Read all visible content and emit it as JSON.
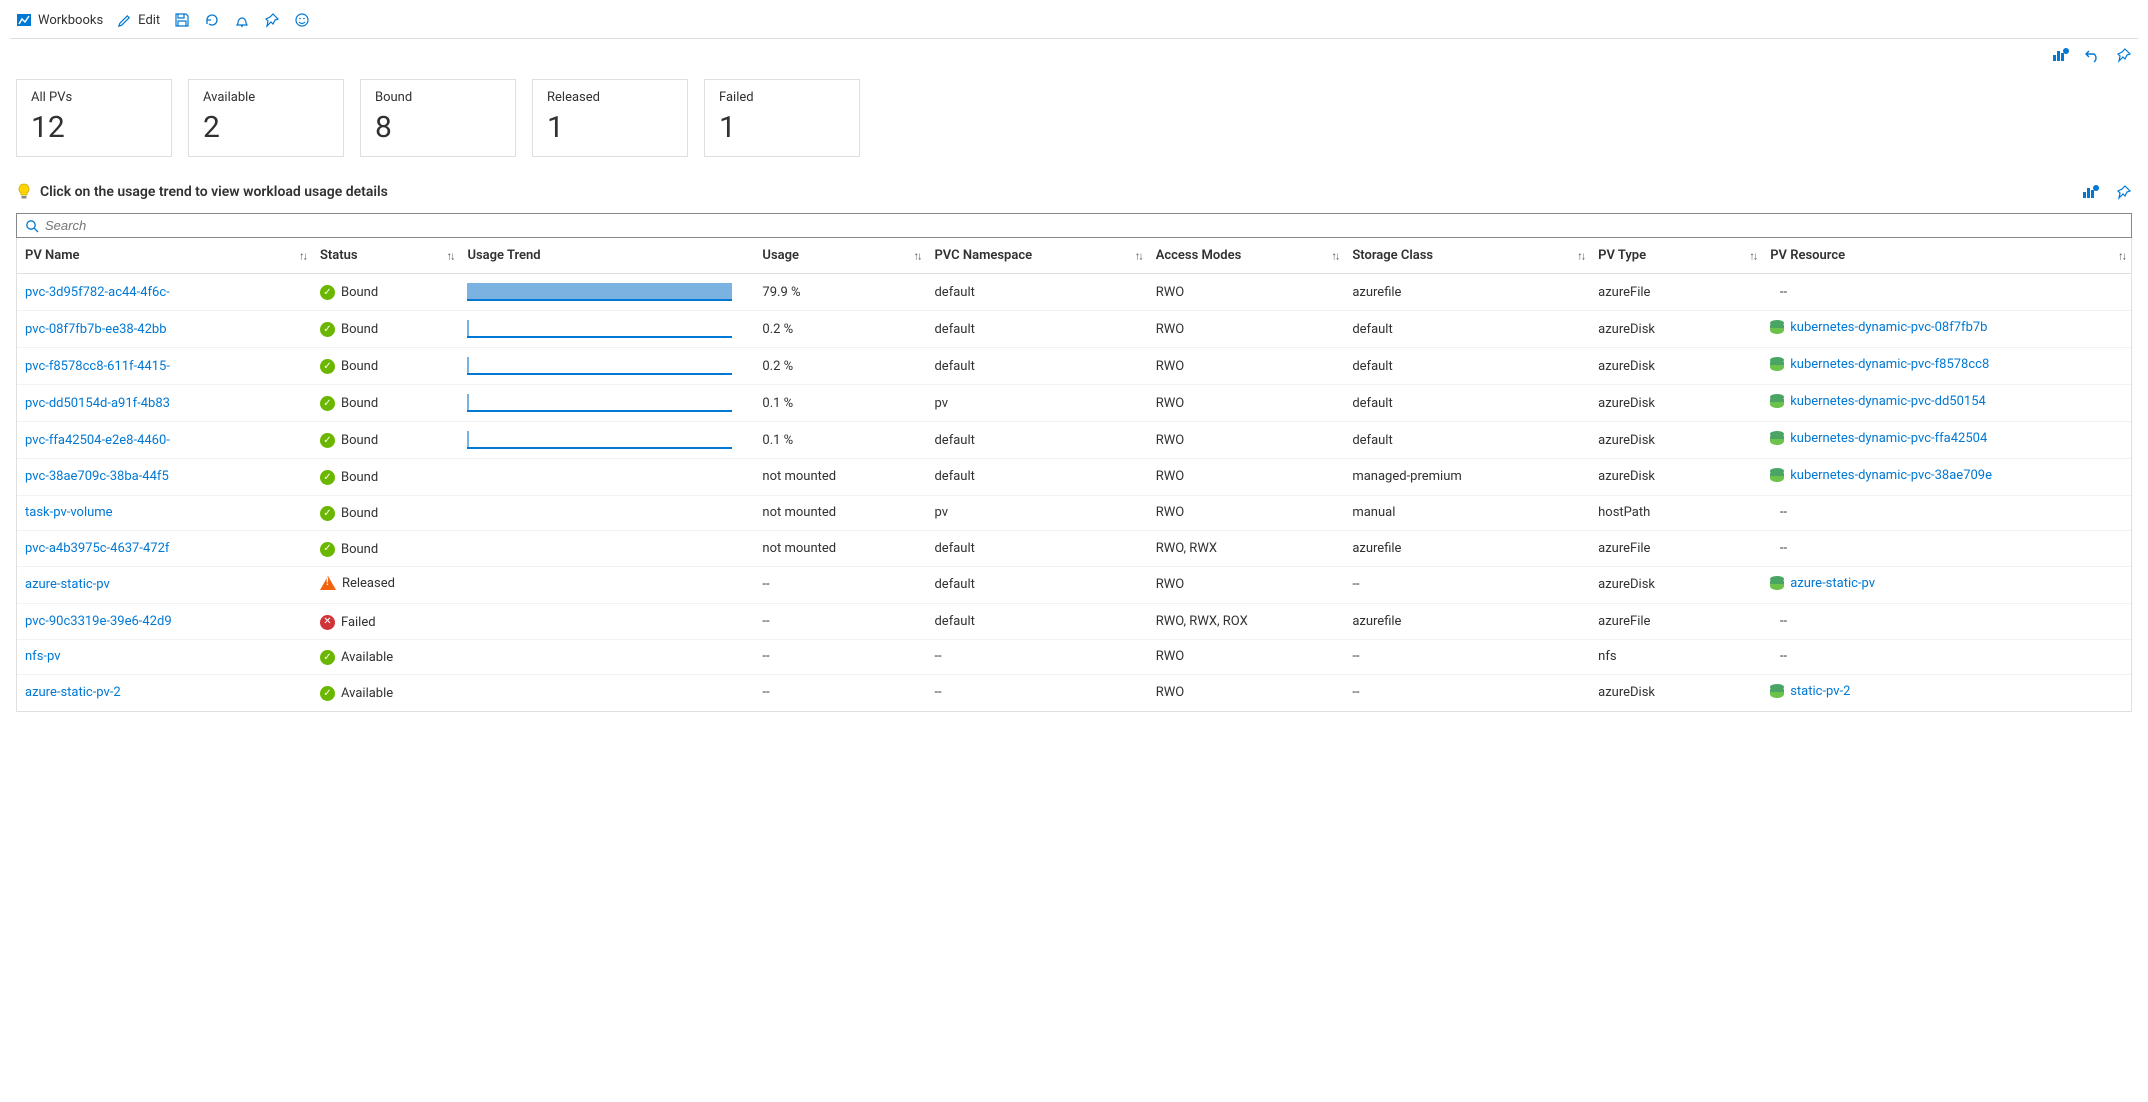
{
  "toolbar": {
    "workbooks_label": "Workbooks",
    "edit_label": "Edit"
  },
  "cards": [
    {
      "label": "All PVs",
      "value": "12"
    },
    {
      "label": "Available",
      "value": "2"
    },
    {
      "label": "Bound",
      "value": "8"
    },
    {
      "label": "Released",
      "value": "1"
    },
    {
      "label": "Failed",
      "value": "1"
    }
  ],
  "hint": "Click on the usage trend to view workload usage details",
  "search_placeholder": "Search",
  "columns": {
    "pv_name": "PV Name",
    "status": "Status",
    "usage_trend": "Usage Trend",
    "usage": "Usage",
    "pvc_namespace": "PVC Namespace",
    "access_modes": "Access Modes",
    "storage_class": "Storage Class",
    "pv_type": "PV Type",
    "pv_resource": "PV Resource"
  },
  "rows": [
    {
      "name": "pvc-3d95f782-ac44-4f6c-",
      "status": "Bound",
      "status_kind": "ok",
      "trend_pct": 100,
      "usage": "79.9 %",
      "ns": "default",
      "access": "RWO",
      "storage": "azurefile",
      "type": "azureFile",
      "resource": "--"
    },
    {
      "name": "pvc-08f7fb7b-ee38-42bb",
      "status": "Bound",
      "status_kind": "ok",
      "trend_pct": 0.5,
      "usage": "0.2 %",
      "ns": "default",
      "access": "RWO",
      "storage": "default",
      "type": "azureDisk",
      "resource": "kubernetes-dynamic-pvc-08f7fb7b"
    },
    {
      "name": "pvc-f8578cc8-611f-4415-",
      "status": "Bound",
      "status_kind": "ok",
      "trend_pct": 0.5,
      "usage": "0.2 %",
      "ns": "default",
      "access": "RWO",
      "storage": "default",
      "type": "azureDisk",
      "resource": "kubernetes-dynamic-pvc-f8578cc8"
    },
    {
      "name": "pvc-dd50154d-a91f-4b83",
      "status": "Bound",
      "status_kind": "ok",
      "trend_pct": 0.3,
      "usage": "0.1 %",
      "ns": "pv",
      "access": "RWO",
      "storage": "default",
      "type": "azureDisk",
      "resource": "kubernetes-dynamic-pvc-dd50154"
    },
    {
      "name": "pvc-ffa42504-e2e8-4460-",
      "status": "Bound",
      "status_kind": "ok",
      "trend_pct": 0.3,
      "usage": "0.1 %",
      "ns": "default",
      "access": "RWO",
      "storage": "default",
      "type": "azureDisk",
      "resource": "kubernetes-dynamic-pvc-ffa42504"
    },
    {
      "name": "pvc-38ae709c-38ba-44f5",
      "status": "Bound",
      "status_kind": "ok",
      "trend_pct": null,
      "usage": "not mounted",
      "ns": "default",
      "access": "RWO",
      "storage": "managed-premium",
      "type": "azureDisk",
      "resource": "kubernetes-dynamic-pvc-38ae709e"
    },
    {
      "name": "task-pv-volume",
      "status": "Bound",
      "status_kind": "ok",
      "trend_pct": null,
      "usage": "not mounted",
      "ns": "pv",
      "access": "RWO",
      "storage": "manual",
      "type": "hostPath",
      "resource": "--"
    },
    {
      "name": "pvc-a4b3975c-4637-472f",
      "status": "Bound",
      "status_kind": "ok",
      "trend_pct": null,
      "usage": "not mounted",
      "ns": "default",
      "access": "RWO, RWX",
      "storage": "azurefile",
      "type": "azureFile",
      "resource": "--"
    },
    {
      "name": "azure-static-pv",
      "status": "Released",
      "status_kind": "warn",
      "trend_pct": null,
      "usage": "--",
      "ns": "default",
      "access": "RWO",
      "storage": "--",
      "type": "azureDisk",
      "resource": "azure-static-pv"
    },
    {
      "name": "pvc-90c3319e-39e6-42d9",
      "status": "Failed",
      "status_kind": "fail",
      "trend_pct": null,
      "usage": "--",
      "ns": "default",
      "access": "RWO, RWX, ROX",
      "storage": "azurefile",
      "type": "azureFile",
      "resource": "--"
    },
    {
      "name": "nfs-pv",
      "status": "Available",
      "status_kind": "ok",
      "trend_pct": null,
      "usage": "--",
      "ns": "--",
      "access": "RWO",
      "storage": "--",
      "type": "nfs",
      "resource": "--"
    },
    {
      "name": "azure-static-pv-2",
      "status": "Available",
      "status_kind": "ok",
      "trend_pct": null,
      "usage": "--",
      "ns": "--",
      "access": "RWO",
      "storage": "--",
      "type": "azureDisk",
      "resource": "static-pv-2"
    }
  ]
}
